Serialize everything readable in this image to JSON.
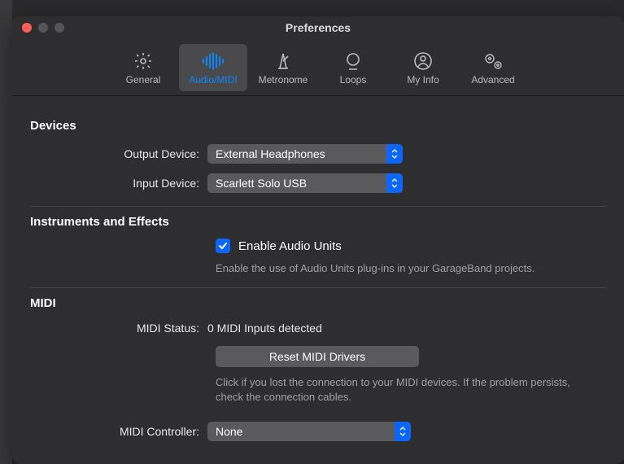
{
  "window": {
    "title": "Preferences"
  },
  "tabs": {
    "general": "General",
    "audio_midi": "Audio/MIDI",
    "metronome": "Metronome",
    "loops": "Loops",
    "my_info": "My Info",
    "advanced": "Advanced"
  },
  "sections": {
    "devices": "Devices",
    "instruments": "Instruments and Effects",
    "midi": "MIDI"
  },
  "devices": {
    "output_label": "Output Device:",
    "output_value": "External Headphones",
    "input_label": "Input Device:",
    "input_value": "Scarlett Solo USB"
  },
  "instruments": {
    "enable_au_label": "Enable Audio Units",
    "enable_au_checked": true,
    "enable_au_hint": "Enable the use of Audio Units plug-ins in your GarageBand projects."
  },
  "midi": {
    "status_label": "MIDI Status:",
    "status_value": "0 MIDI Inputs detected",
    "reset_button": "Reset MIDI Drivers",
    "reset_hint": "Click if you lost the connection to your MIDI devices. If the problem persists, check the connection cables.",
    "controller_label": "MIDI Controller:",
    "controller_value": "None"
  },
  "colors": {
    "accent": "#0a66ff",
    "tab_selected_text": "#0a84ff"
  }
}
